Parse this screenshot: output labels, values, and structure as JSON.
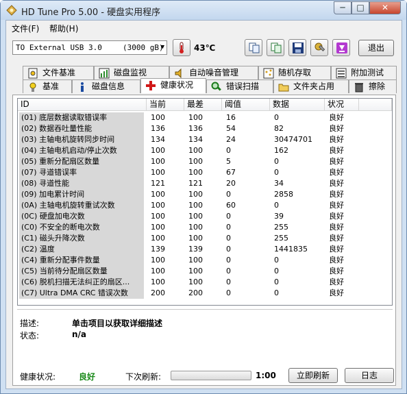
{
  "window": {
    "title": "HD Tune Pro 5.00 - 硬盘实用程序",
    "min_label": "─",
    "max_label": "□",
    "close_label": "✕"
  },
  "menu": [
    {
      "label": "文件(F)"
    },
    {
      "label": "帮助(H)"
    }
  ],
  "toolbar": {
    "drive": {
      "name": "TO External USB 3.0",
      "capacity": "(3000 gB)"
    },
    "temperature": "43℃",
    "exit_label": "退出"
  },
  "tabs_top": [
    {
      "label": "文件基准",
      "icon": "file-benchmark-icon"
    },
    {
      "label": "磁盘监视",
      "icon": "disk-monitor-icon"
    },
    {
      "label": "自动噪音管理",
      "icon": "speaker-icon"
    },
    {
      "label": "随机存取",
      "icon": "random-access-icon"
    },
    {
      "label": "附加测试",
      "icon": "extra-tests-icon"
    }
  ],
  "tabs_bottom": [
    {
      "label": "基准",
      "icon": "benchmark-icon"
    },
    {
      "label": "磁盘信息",
      "icon": "info-icon"
    },
    {
      "label": "健康状况",
      "icon": "health-cross-icon",
      "active": true
    },
    {
      "label": "错误扫描",
      "icon": "magnifier-icon"
    },
    {
      "label": "文件夹占用",
      "icon": "folder-icon"
    },
    {
      "label": "擦除",
      "icon": "trash-icon"
    }
  ],
  "table": {
    "headers": {
      "id": "ID",
      "current": "当前",
      "worst": "最差",
      "threshold": "阈值",
      "data": "数据",
      "status": "状况"
    },
    "rows": [
      {
        "id": "(01) 底层数据读取错误率",
        "current": "100",
        "worst": "100",
        "threshold": "16",
        "data": "0",
        "status": "良好"
      },
      {
        "id": "(02) 数据吞吐量性能",
        "current": "136",
        "worst": "136",
        "threshold": "54",
        "data": "82",
        "status": "良好"
      },
      {
        "id": "(03) 主轴电机旋转同步时间",
        "current": "134",
        "worst": "134",
        "threshold": "24",
        "data": "30474701",
        "status": "良好"
      },
      {
        "id": "(04) 主轴电机启动/停止次数",
        "current": "100",
        "worst": "100",
        "threshold": "0",
        "data": "162",
        "status": "良好"
      },
      {
        "id": "(05) 重新分配扇区数量",
        "current": "100",
        "worst": "100",
        "threshold": "5",
        "data": "0",
        "status": "良好"
      },
      {
        "id": "(07) 寻道错误率",
        "current": "100",
        "worst": "100",
        "threshold": "67",
        "data": "0",
        "status": "良好"
      },
      {
        "id": "(08) 寻道性能",
        "current": "121",
        "worst": "121",
        "threshold": "20",
        "data": "34",
        "status": "良好"
      },
      {
        "id": "(09) 加电累计时间",
        "current": "100",
        "worst": "100",
        "threshold": "0",
        "data": "2858",
        "status": "良好"
      },
      {
        "id": "(0A) 主轴电机旋转重试次数",
        "current": "100",
        "worst": "100",
        "threshold": "60",
        "data": "0",
        "status": "良好"
      },
      {
        "id": "(0C) 硬盘加电次数",
        "current": "100",
        "worst": "100",
        "threshold": "0",
        "data": "39",
        "status": "良好"
      },
      {
        "id": "(C0) 不安全的断电次数",
        "current": "100",
        "worst": "100",
        "threshold": "0",
        "data": "255",
        "status": "良好"
      },
      {
        "id": "(C1) 磁头升降次数",
        "current": "100",
        "worst": "100",
        "threshold": "0",
        "data": "255",
        "status": "良好"
      },
      {
        "id": "(C2) 温度",
        "current": "139",
        "worst": "139",
        "threshold": "0",
        "data": "1441835",
        "status": "良好"
      },
      {
        "id": "(C4) 重新分配事件数量",
        "current": "100",
        "worst": "100",
        "threshold": "0",
        "data": "0",
        "status": "良好"
      },
      {
        "id": "(C5) 当前待分配扇区数量",
        "current": "100",
        "worst": "100",
        "threshold": "0",
        "data": "0",
        "status": "良好"
      },
      {
        "id": "(C6) 脱机扫描无法纠正的扇区...",
        "current": "100",
        "worst": "100",
        "threshold": "0",
        "data": "0",
        "status": "良好"
      },
      {
        "id": "(C7) Ultra DMA CRC 错误次数",
        "current": "200",
        "worst": "200",
        "threshold": "0",
        "data": "0",
        "status": "良好"
      }
    ]
  },
  "description": {
    "label": "描述:",
    "value": "单击项目以获取详细描述"
  },
  "state": {
    "label": "状态:",
    "value": "n/a"
  },
  "footer": {
    "health_label": "健康状况:",
    "health_value": "良好",
    "next_refresh_label": "下次刷新:",
    "timer": "1:00",
    "refresh_button": "立即刷新",
    "log_button": "日志"
  },
  "colors": {
    "good": "#1a8a1a",
    "id_bg": "#d8d8d8",
    "accent": "#cfe0f2"
  }
}
